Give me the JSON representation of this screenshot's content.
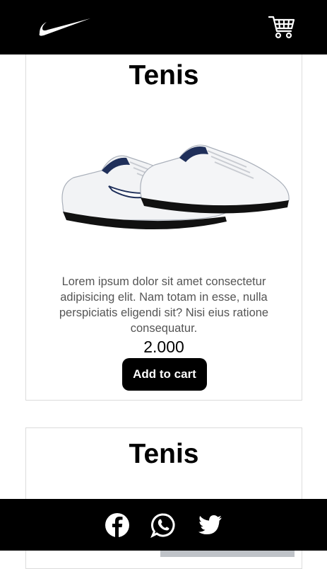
{
  "header": {
    "logo_icon": "nike-swoosh-icon",
    "cart_icon": "shopping-cart-icon",
    "background": "#000000"
  },
  "products": [
    {
      "title": "Tenis",
      "description": "Lorem ipsum dolor sit amet consectetur adipisicing elit. Nam totam in esse, nulla perspiciatis eligendi sit? Nisi eius ratione consequatur.",
      "price": "2.000",
      "button_label": "Add to cart"
    },
    {
      "title": "Tenis"
    }
  ],
  "footer": {
    "icons": [
      "facebook-icon",
      "whatsapp-icon",
      "twitter-icon"
    ]
  }
}
